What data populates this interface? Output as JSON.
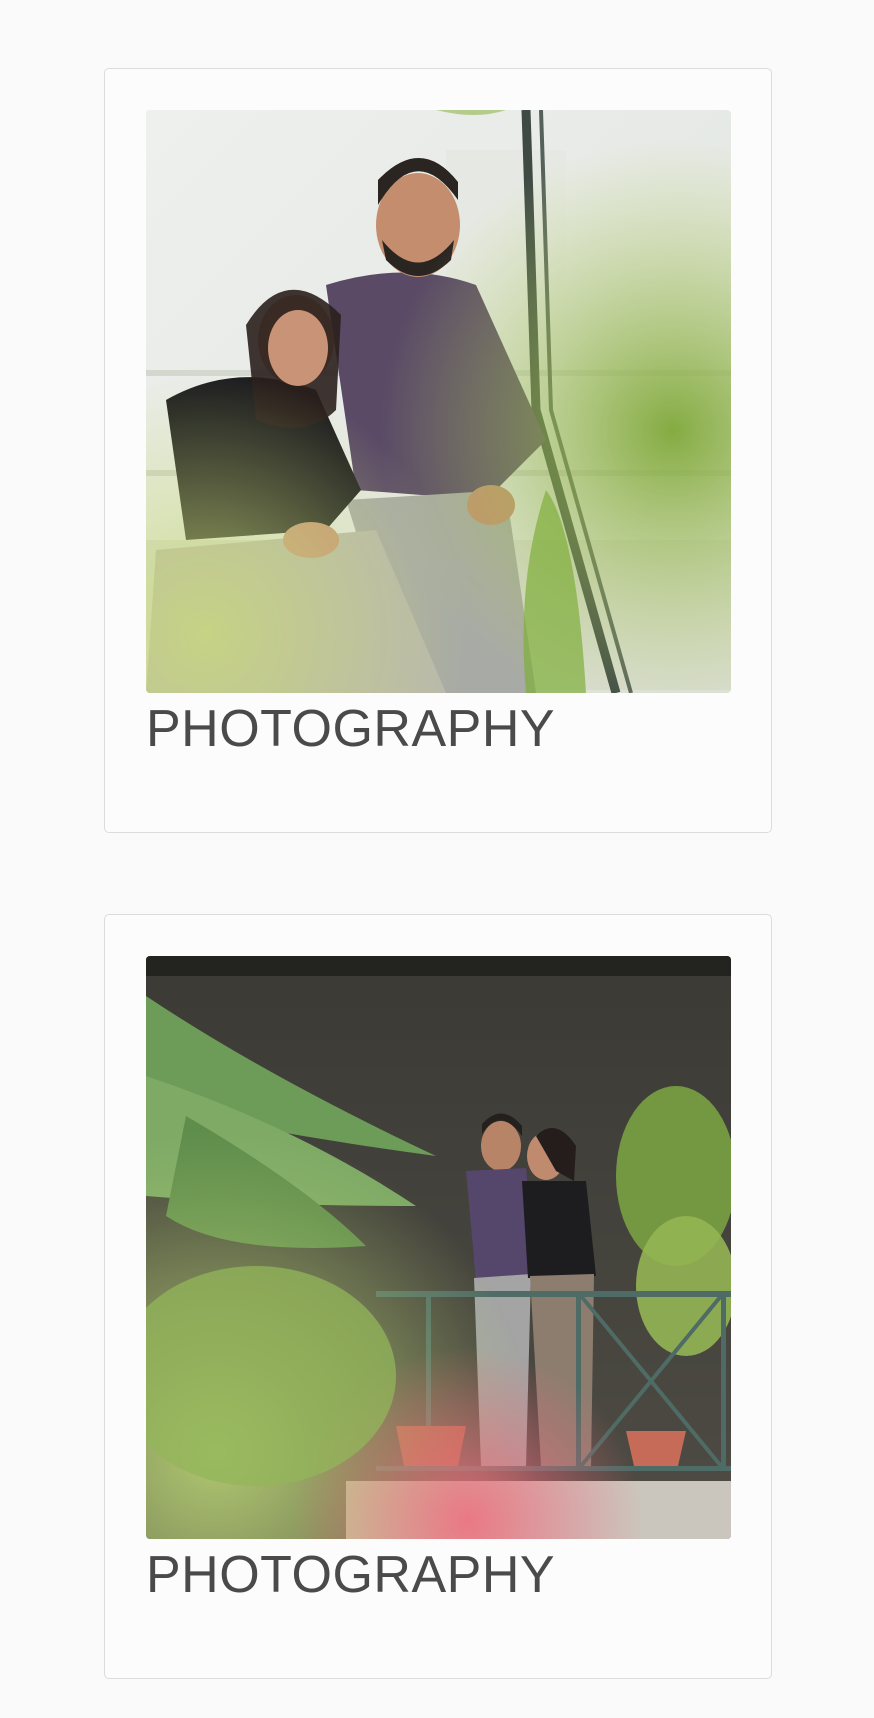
{
  "cards": [
    {
      "image_alt": "Couple laughing while sitting on garden stairs",
      "caption": "PHOTOGRAPHY"
    },
    {
      "image_alt": "Couple standing forehead to forehead on a balcony among plants",
      "caption": "PHOTOGRAPHY"
    }
  ]
}
